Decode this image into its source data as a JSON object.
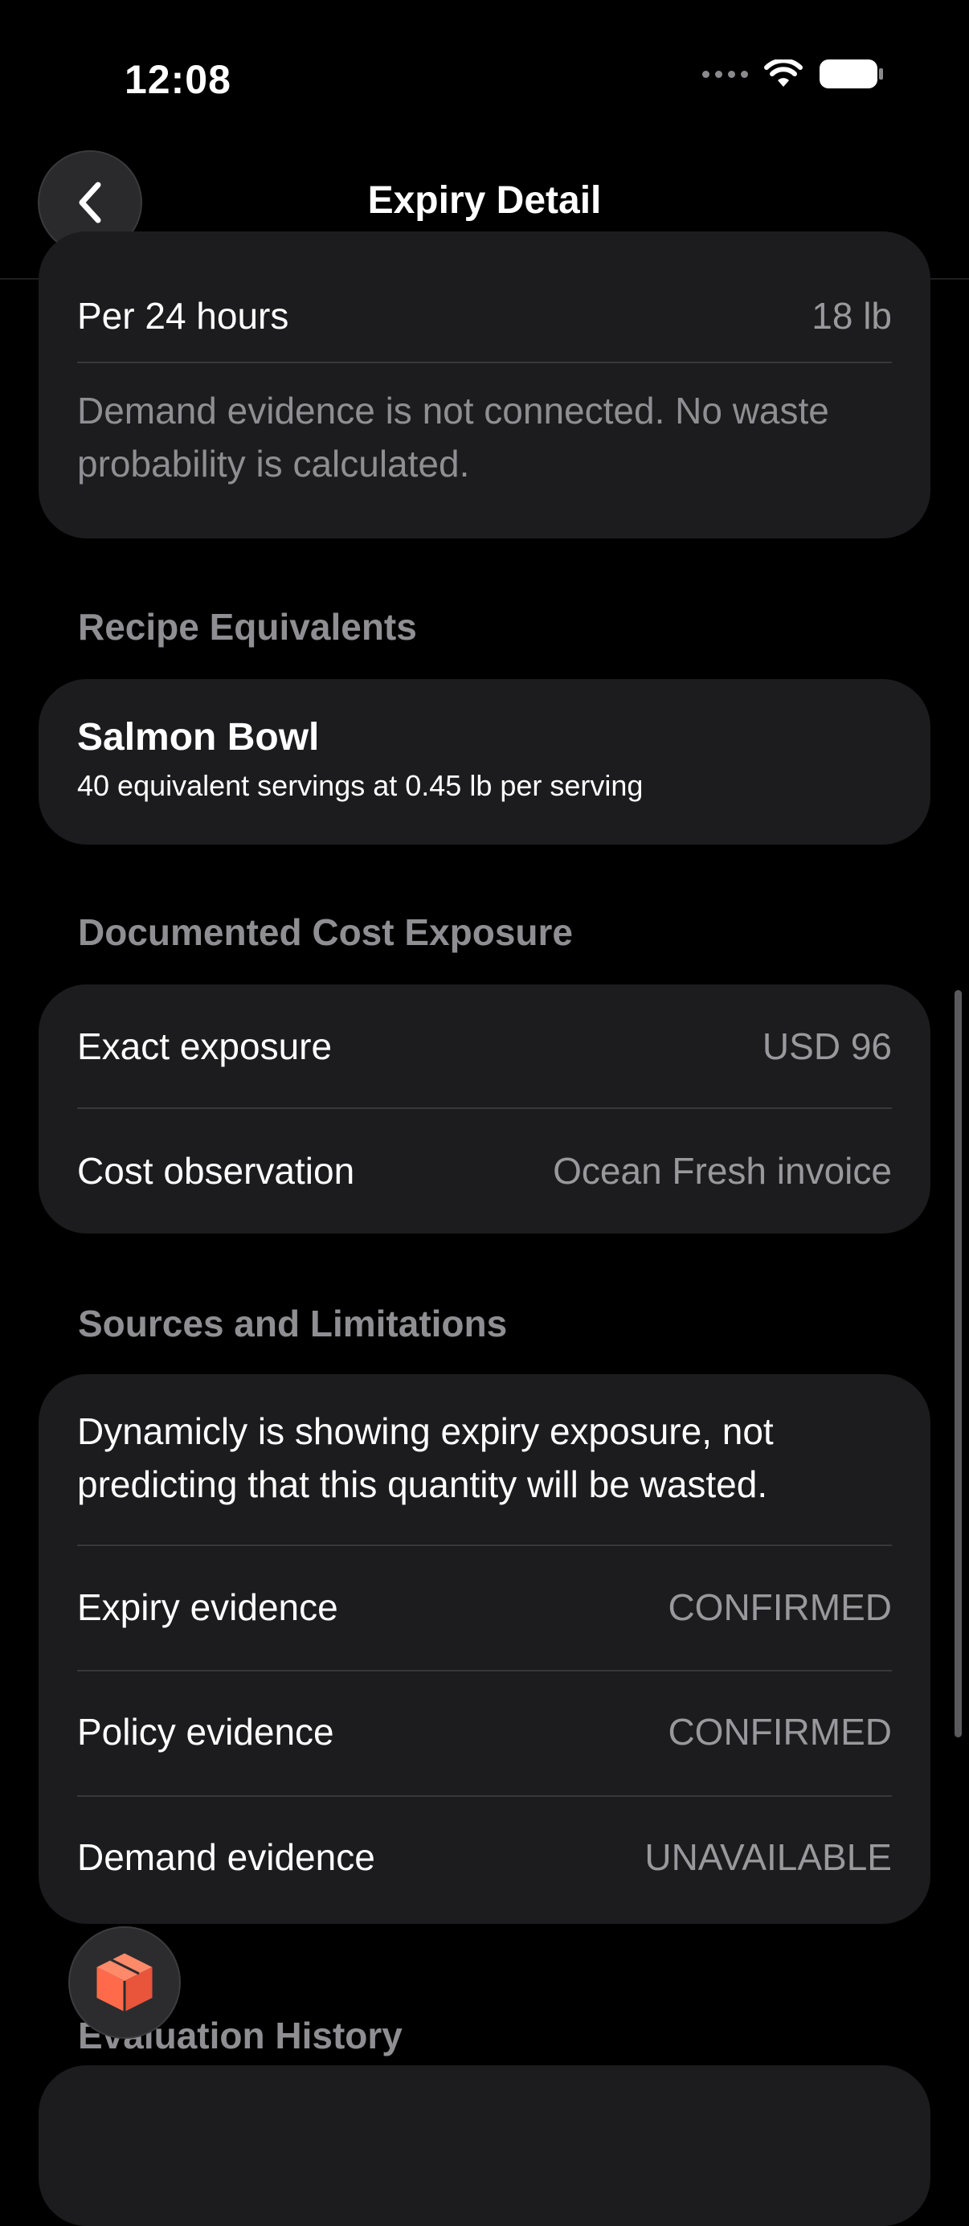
{
  "status_bar": {
    "time": "12:08"
  },
  "nav": {
    "title": "Expiry Detail"
  },
  "projection_card": {
    "rows": [
      {
        "label": "Per 24 hours",
        "value": "18 lb"
      }
    ],
    "note": "Demand evidence is not connected. No waste probability is calculated."
  },
  "recipe_section": {
    "header": "Recipe Equivalents",
    "item": {
      "title": "Salmon Bowl",
      "subtitle": "40 equivalent servings at 0.45 lb per serving"
    }
  },
  "cost_section": {
    "header": "Documented Cost Exposure",
    "rows": [
      {
        "label": "Exact exposure",
        "value": "USD 96"
      },
      {
        "label": "Cost observation",
        "value": "Ocean Fresh invoice"
      }
    ]
  },
  "sources_section": {
    "header": "Sources and Limitations",
    "note": "Dynamicly is showing expiry exposure, not predicting that this quantity will be wasted.",
    "rows": [
      {
        "label": "Expiry evidence",
        "value": "CONFIRMED"
      },
      {
        "label": "Policy evidence",
        "value": "CONFIRMED"
      },
      {
        "label": "Demand evidence",
        "value": "UNAVAILABLE"
      }
    ]
  },
  "history_section": {
    "header": "Evaluation History"
  },
  "colors": {
    "background": "#000000",
    "card": "#1c1c1e",
    "secondary_text": "#98989d",
    "section_header": "#8e8e93",
    "fab_accent": "#ff6b4a"
  },
  "icons": {
    "back": "chevron-left-icon",
    "fab": "box-icon",
    "wifi": "wifi-icon",
    "battery": "battery-icon"
  }
}
